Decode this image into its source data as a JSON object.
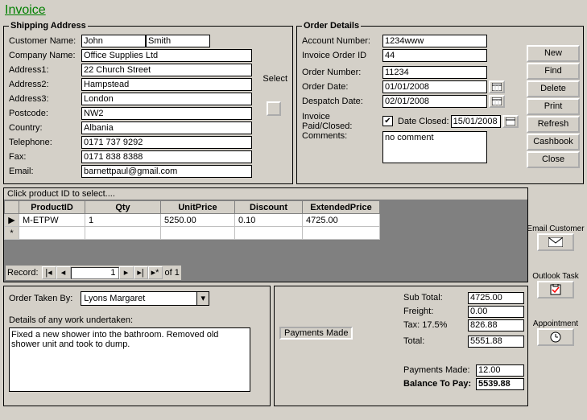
{
  "title": "Invoice",
  "shipping": {
    "legend": "Shipping Address",
    "labels": {
      "customer": "Customer Name:",
      "company": "Company Name:",
      "addr1": "Address1:",
      "addr2": "Address2:",
      "addr3": "Address3:",
      "postcode": "Postcode:",
      "country": "Country:",
      "telephone": "Telephone:",
      "fax": "Fax:",
      "email": "Email:"
    },
    "values": {
      "first_name": "John",
      "last_name": "Smith",
      "company": "Office Supplies Ltd",
      "addr1": "22 Church Street",
      "addr2": "Hampstead",
      "addr3": "London",
      "postcode": "NW2",
      "country": "Albania",
      "telephone": "0171 737 9292",
      "fax": "0171 838 8388",
      "email": "barnettpaul@gmail.com"
    },
    "select_label": "Select"
  },
  "order": {
    "legend": "Order Details",
    "labels": {
      "account": "Account Number:",
      "invoice_id": "Invoice Order ID",
      "order_no": "Order Number:",
      "order_date": "Order Date:",
      "despatch": "Despatch Date:",
      "paid": "Invoice Paid/Closed:",
      "date_closed": "Date Closed:",
      "comments": "Comments:"
    },
    "values": {
      "account": "1234www",
      "invoice_id": "44",
      "order_no": "11234",
      "order_date": "01/01/2008",
      "despatch": "02/01/2008",
      "paid_checked": true,
      "date_closed": "15/01/2008",
      "comments": "no comment"
    }
  },
  "sidebar": {
    "buttons": [
      "New",
      "Find",
      "Delete",
      "Print",
      "Refresh",
      "Cashbook",
      "Close"
    ],
    "email_label": "Email Customer",
    "outlook_label": "Outlook Task",
    "appointment_label": "Appointment"
  },
  "grid": {
    "caption": "Click product ID to select....",
    "headers": [
      "ProductID",
      "Qty",
      "UnitPrice",
      "Discount",
      "ExtendedPrice"
    ],
    "rows": [
      {
        "ProductID": "M-ETPW",
        "Qty": "1",
        "UnitPrice": "5250.00",
        "Discount": "0.10",
        "ExtendedPrice": "4725.00"
      }
    ],
    "record_nav": {
      "label": "Record:",
      "current": "1",
      "of_label": "of",
      "total": "1"
    }
  },
  "work": {
    "taken_by_label": "Order Taken By:",
    "taken_by_value": "Lyons Margaret",
    "details_label": "Details of any work undertaken:",
    "details_value": "Fixed a new shower into the bathroom. Removed old shower unit and took to dump."
  },
  "totals": {
    "payments_made_btn": "Payments Made",
    "labels": {
      "subtotal": "Sub Total:",
      "freight": "Freight:",
      "tax": "Tax: 17.5%",
      "total": "Total:",
      "payments": "Payments Made:",
      "balance": "Balance To Pay:"
    },
    "values": {
      "subtotal": "4725.00",
      "freight": "0.00",
      "tax": "826.88",
      "total": "5551.88",
      "payments": "12.00",
      "balance": "5539.88"
    }
  }
}
